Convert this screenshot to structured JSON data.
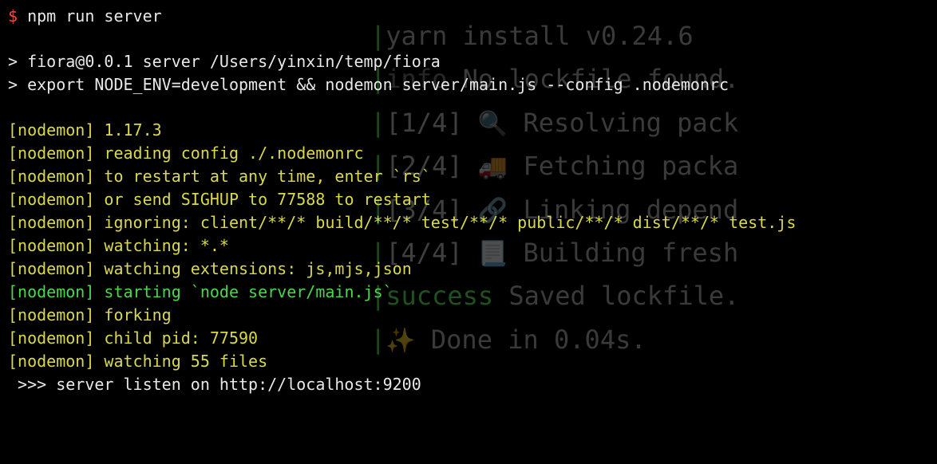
{
  "foreground": {
    "prompt_symbol": "$",
    "command": "npm run server",
    "script_line1": "> fiora@0.0.1 server /Users/yinxin/temp/fiora",
    "script_line2": "> export NODE_ENV=development && nodemon server/main.js --config .nodemonrc",
    "nodemon": {
      "prefix": "[nodemon]",
      "version": " 1.17.3",
      "reading": " reading config ./.nodemonrc",
      "restart": " to restart at any time, enter `rs`",
      "sighup": " or send SIGHUP to 77588 to restart",
      "ignoring": " ignoring: client/**/* build/**/* test/**/* public/**/* dist/**/* test.js",
      "watching": " watching: *.*",
      "extensions": " watching extensions: js,mjs,json",
      "starting": " starting `node server/main.js`",
      "forking": " forking",
      "childpid": " child pid: 77590",
      "watchfiles": " watching 55 files"
    },
    "server_listen": " >>> server listen on http://localhost:9200"
  },
  "background": {
    "pipe": "|",
    "yarn_title": "yarn install v0.24.6",
    "info_prefix": "info",
    "no_lockfile": " No lockfile found.",
    "step1_num": "[1/4]",
    "step1_icon": "🔍",
    "step1_text": "  Resolving pack",
    "step2_num": "[2/4]",
    "step2_icon": "🚚",
    "step2_text": "  Fetching packa",
    "step3_num": "[3/4]",
    "step3_icon": "🔗",
    "step3_text": "  Linking depend",
    "step4_num": "[4/4]",
    "step4_icon": "📃",
    "step4_text": "  Building fresh",
    "success_prefix": "success",
    "success_text": " Saved lockfile.",
    "done_icon": "✨",
    "done_text": "  Done in 0.04s."
  }
}
